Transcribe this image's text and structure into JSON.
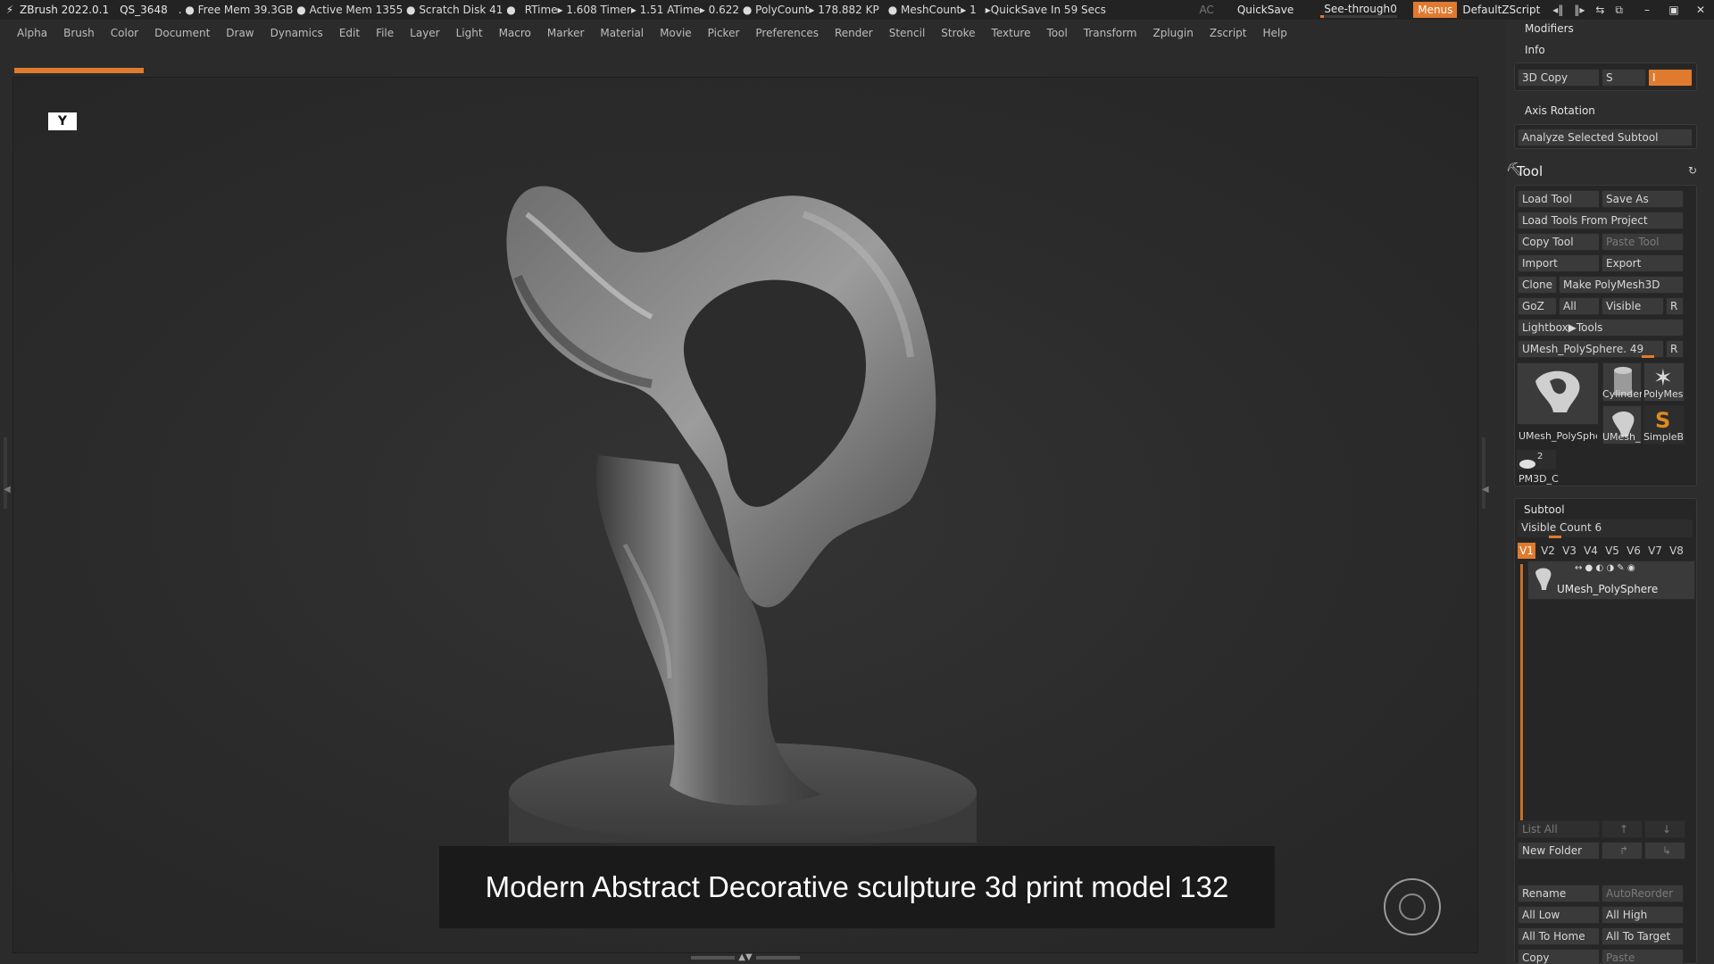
{
  "titlebar": {
    "app": "ZBrush 2022.0.1",
    "doc": "QS_3648",
    "stats": [
      ". ● Free Mem 39.3GB ● Active Mem 1355 ● Scratch Disk 41 ●",
      "RTime▸ 1.608 Timer▸ 1.51 ATime▸ 0.622 ● PolyCount▸ 178.882 KP",
      "● MeshCount▸ 1",
      "▸QuickSave In 59 Secs"
    ],
    "ac": "AC",
    "quicksave": "QuickSave",
    "seethrough_label": "See-through",
    "seethrough_value": "0",
    "seethrough_level": 0.0,
    "menus": "Menus",
    "script": "DefaultZScript"
  },
  "menubar": [
    "Alpha",
    "Brush",
    "Color",
    "Document",
    "Draw",
    "Dynamics",
    "Edit",
    "File",
    "Layer",
    "Light",
    "Macro",
    "Marker",
    "Material",
    "Movie",
    "Picker",
    "Preferences",
    "Render",
    "Stencil",
    "Stroke",
    "Texture",
    "Tool",
    "Transform",
    "Zplugin",
    "Zscript",
    "Help"
  ],
  "viewport": {
    "caption": "Modern Abstract Decorative sculpture 3d print model 132"
  },
  "panel": {
    "modifiers": "Modifiers",
    "info": "Info",
    "copy3d": "3D Copy",
    "s_label": "S",
    "i_value": "I",
    "axis_rotation": "Axis Rotation",
    "analyze": "Analyze Selected Subtool",
    "tool_title": "Tool",
    "load_tool": "Load Tool",
    "save_as": "Save As",
    "load_from_project": "Load Tools From Project",
    "copy_tool": "Copy Tool",
    "paste_tool": "Paste Tool",
    "import": "Import",
    "export": "Export",
    "clone": "Clone",
    "make_polymesh": "Make PolyMesh3D",
    "goz": "GoZ",
    "all": "All",
    "visible": "Visible",
    "r": "R",
    "lightbox_tools": "Lightbox▶Tools",
    "current_tool": "UMesh_PolySphere. 49",
    "thumbs": [
      "UMesh_PolySphe",
      "Cylinder",
      "PolyMes",
      "UMesh_",
      "SimpleB",
      "PM3D_C"
    ],
    "pm3d_count": "2",
    "subtool": "Subtool",
    "visible_count": "Visible Count 6",
    "vtabs": [
      "V1",
      "V2",
      "V3",
      "V4",
      "V5",
      "V6",
      "V7",
      "V8"
    ],
    "subtool_item": "UMesh_PolySphere",
    "list_all": "List All",
    "new_folder": "New Folder",
    "rename": "Rename",
    "autoreorder": "AutoReorder",
    "all_low": "All Low",
    "all_high": "All High",
    "all_to_home": "All To Home",
    "all_to_target": "All To Target",
    "copy": "Copy",
    "paste": "Paste"
  },
  "colors": {
    "accent": "#e07a2e",
    "bg": "#2b2b2b"
  }
}
